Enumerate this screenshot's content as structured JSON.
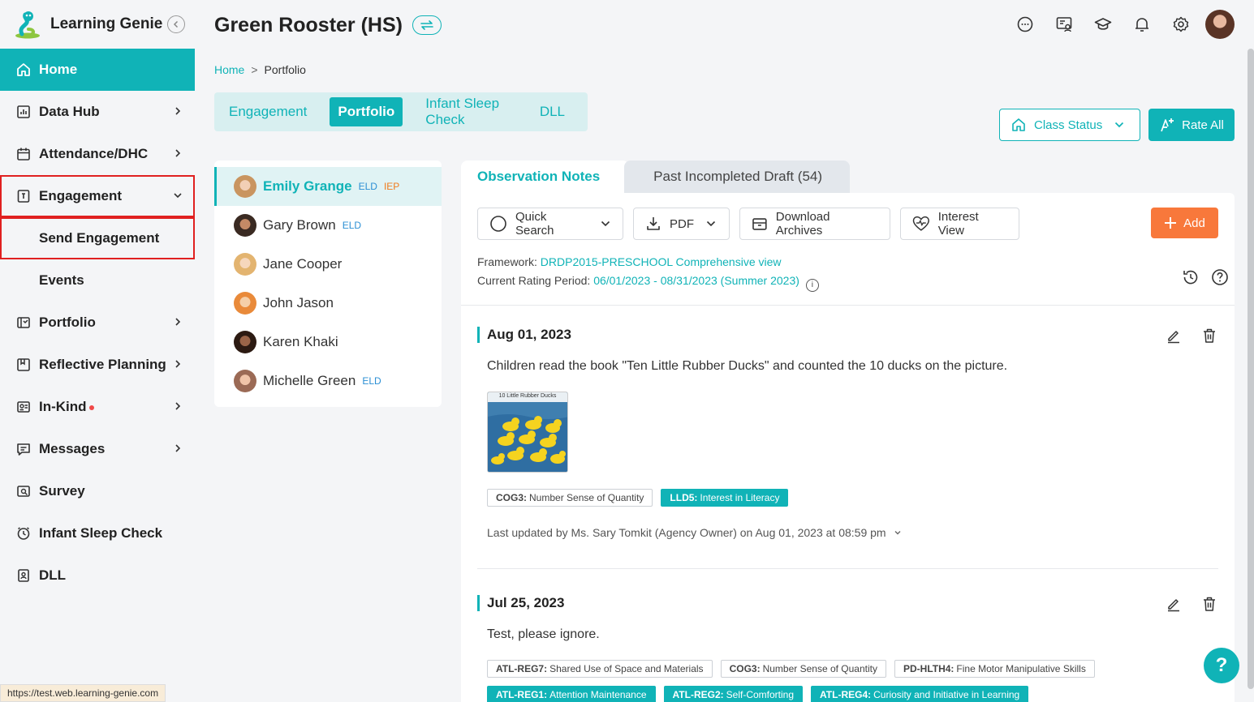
{
  "app": {
    "name": "Learning Genie"
  },
  "sidebar": {
    "items": [
      {
        "label": "Home",
        "icon": "home-icon",
        "active": true
      },
      {
        "label": "Data Hub",
        "icon": "chart-icon",
        "chevron": true
      },
      {
        "label": "Attendance/DHC",
        "icon": "calendar-icon",
        "chevron": true
      },
      {
        "label": "Engagement",
        "icon": "engagement-icon",
        "expanded": true
      },
      {
        "label": "Send Engagement",
        "sub": true
      },
      {
        "label": "Events",
        "sub": true
      },
      {
        "label": "Portfolio",
        "icon": "portfolio-icon",
        "chevron": true
      },
      {
        "label": "Reflective Planning",
        "icon": "planning-icon",
        "chevron": true
      },
      {
        "label": "In-Kind",
        "icon": "inkind-icon",
        "chevron": true,
        "badge_dot": true
      },
      {
        "label": "Messages",
        "icon": "message-icon",
        "chevron": true
      },
      {
        "label": "Survey",
        "icon": "survey-icon"
      },
      {
        "label": "Infant Sleep Check",
        "icon": "clock-icon"
      },
      {
        "label": "DLL",
        "icon": "dll-icon"
      }
    ]
  },
  "header": {
    "title": "Green Rooster (HS)"
  },
  "breadcrumb": {
    "home": "Home",
    "sep": ">",
    "current": "Portfolio"
  },
  "module_tabs": [
    {
      "label": "Engagement"
    },
    {
      "label": "Portfolio",
      "active": true
    },
    {
      "label": "Infant Sleep Check"
    },
    {
      "label": "DLL"
    }
  ],
  "actions": {
    "class_status": "Class Status",
    "rate_all": "Rate All"
  },
  "children": [
    {
      "name": "Emily Grange",
      "tags": [
        "ELD",
        "IEP"
      ],
      "selected": true
    },
    {
      "name": "Gary Brown",
      "tags": [
        "ELD"
      ]
    },
    {
      "name": "Jane Cooper",
      "tags": []
    },
    {
      "name": "John Jason",
      "tags": []
    },
    {
      "name": "Karen Khaki",
      "tags": []
    },
    {
      "name": "Michelle Green",
      "tags": [
        "ELD"
      ]
    }
  ],
  "notes_tabs": {
    "active": "Observation Notes",
    "inactive": "Past Incompleted Draft (54)"
  },
  "toolbar": {
    "quick_search": "Quick Search",
    "pdf": "PDF",
    "download_archives": "Download Archives",
    "interest_view": "Interest View",
    "add": "Add"
  },
  "framework": {
    "label": "Framework:",
    "value": "DRDP2015-PRESCHOOL Comprehensive view",
    "period_label": "Current Rating Period:",
    "period_value": "06/01/2023 - 08/31/2023 (Summer 2023)"
  },
  "notes": [
    {
      "date": "Aug 01, 2023",
      "text": "Children read the book \"Ten Little Rubber Ducks\" and counted the 10 ducks on the picture.",
      "image_caption": "10 Little Rubber Ducks",
      "tags": [
        {
          "code": "COG3:",
          "name": "Number Sense of Quantity",
          "highlight": false
        },
        {
          "code": "LLD5:",
          "name": "Interest in Literacy",
          "highlight": true
        }
      ],
      "updated": "Last updated by Ms. Sary Tomkit (Agency Owner) on Aug 01, 2023 at 08:59 pm"
    },
    {
      "date": "Jul 25, 2023",
      "text": "Test, please ignore.",
      "tags": [
        {
          "code": "ATL-REG7:",
          "name": "Shared Use of Space and Materials",
          "highlight": false
        },
        {
          "code": "COG3:",
          "name": "Number Sense of Quantity",
          "highlight": false
        },
        {
          "code": "PD-HLTH4:",
          "name": "Fine Motor Manipulative Skills",
          "highlight": false
        },
        {
          "code": "ATL-REG1:",
          "name": "Attention Maintenance",
          "highlight": true
        },
        {
          "code": "ATL-REG2:",
          "name": "Self-Comforting",
          "highlight": true
        },
        {
          "code": "ATL-REG4:",
          "name": "Curiosity and Initiative in Learning",
          "highlight": true
        }
      ]
    }
  ],
  "help": {
    "label": "?"
  },
  "status_bar": {
    "url": "https://test.web.learning-genie.com"
  },
  "colors": {
    "accent": "#10b3b7",
    "orange": "#f8783b",
    "highlight_border": "#e02020"
  }
}
